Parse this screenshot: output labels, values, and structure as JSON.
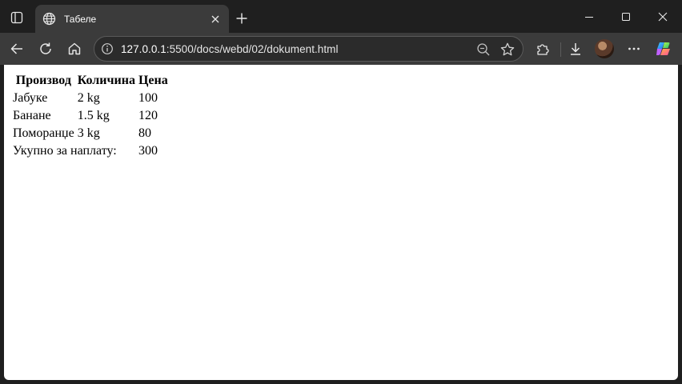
{
  "browser": {
    "tab": {
      "title": "Табеле"
    },
    "address": {
      "host": "127.0.0.1",
      "path": ":5500/docs/webd/02/dokument.html"
    },
    "icons": {
      "tab_actions": "tab-actions-icon",
      "favicon": "globe-icon",
      "close": "close-icon",
      "new_tab": "plus-icon",
      "back": "back-arrow-icon",
      "reload": "reload-icon",
      "home": "home-icon",
      "info": "info-icon",
      "zoom": "zoom-out-icon",
      "favorite": "star-icon",
      "extensions": "puzzle-icon",
      "downloads": "download-icon",
      "menu": "ellipsis-icon",
      "copilot": "copilot-icon"
    },
    "colors": {
      "frame": "#1f1f1f",
      "toolbar": "#3b3b3b",
      "page": "#ffffff"
    }
  },
  "page": {
    "table": {
      "headers": [
        "Производ",
        "Количина",
        "Цена"
      ],
      "rows": [
        [
          "Јабуке",
          "2 kg",
          "100"
        ],
        [
          "Банане",
          "1.5 kg",
          "120"
        ],
        [
          "Поморанџе",
          "3 kg",
          "80"
        ]
      ],
      "total": {
        "label": "Укупно за наплату:",
        "value": "300"
      }
    }
  }
}
